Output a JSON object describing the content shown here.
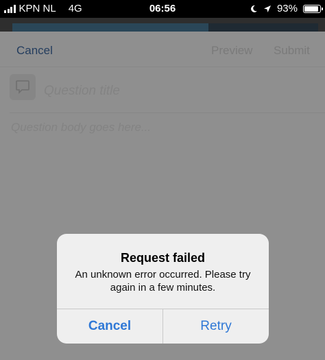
{
  "status_bar": {
    "carrier": "KPN NL",
    "network": "4G",
    "time": "06:56",
    "battery": "93%",
    "battery_level": 0.93,
    "icons": [
      "signal-icon",
      "moon-icon",
      "location-arrow-icon",
      "battery-icon"
    ]
  },
  "nav": {
    "cancel_label": "Cancel",
    "preview_label": "Preview",
    "submit_label": "Submit"
  },
  "form": {
    "title_placeholder": "Question title",
    "body_placeholder": "Question body goes here...",
    "title_icon": "speech-bubble-icon"
  },
  "alert": {
    "title": "Request failed",
    "message": "An unknown error occurred. Please try again in a few minutes.",
    "cancel_label": "Cancel",
    "retry_label": "Retry"
  },
  "colors": {
    "accent": "#2f78d6",
    "overlay": "#8f8f8f",
    "alert_bg": "#efefef"
  }
}
